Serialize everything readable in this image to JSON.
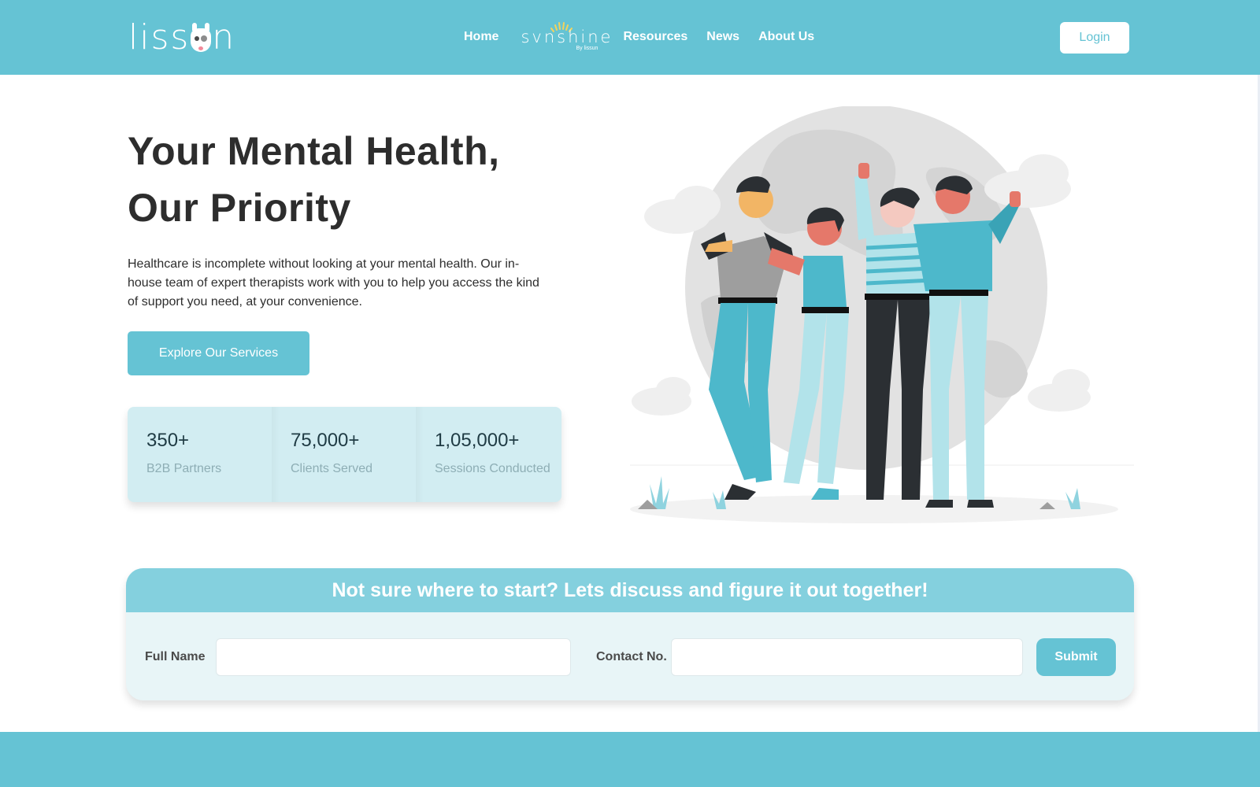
{
  "header": {
    "logo": {
      "text_left": "liss",
      "text_right": "n",
      "alt": "lissun"
    },
    "nav": {
      "home": "Home",
      "sunshine": {
        "word": "svnshine",
        "tagline": "By lissun"
      },
      "resources": "Resources",
      "news": "News",
      "about": "About Us"
    },
    "login_label": "Login"
  },
  "hero": {
    "title_line1": "Your Mental Health,",
    "title_line2": "Our Priority",
    "description": "Healthcare is incomplete without looking at your mental health. Our in-house team of expert therapists work with you to help you access the kind of support you need, at your convenience.",
    "cta_label": "Explore Our Services",
    "illustration_alt": "Group of four friends standing together in front of a globe"
  },
  "stats": [
    {
      "value": "350+",
      "label": "B2B Partners"
    },
    {
      "value": "75,000+",
      "label": "Clients Served"
    },
    {
      "value": "1,05,000+",
      "label": "Sessions Conducted"
    }
  ],
  "contact": {
    "title": "Not sure where to start? Lets discuss and figure it out together!",
    "full_name_label": "Full Name",
    "full_name_value": "",
    "contact_label": "Contact No.",
    "contact_value": "",
    "submit_label": "Submit"
  },
  "colors": {
    "brand": "#65c3d4",
    "brand_light": "#84d0de",
    "stats_bg": "#d2edf2",
    "card_bg": "#e8f5f7",
    "text_dark": "#2d2d2d"
  }
}
